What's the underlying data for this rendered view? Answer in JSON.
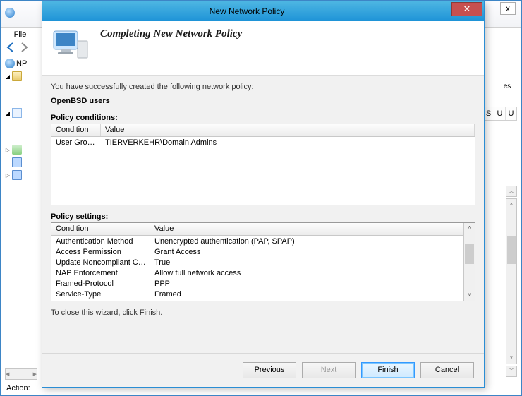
{
  "bg": {
    "file_menu": "File",
    "tree_root": "NP",
    "action_label": "Action:",
    "close_x": "x",
    "detail": "es",
    "cols": [
      "S",
      "U",
      "U"
    ]
  },
  "dialog": {
    "title": "New Network Policy",
    "heading": "Completing New Network Policy",
    "intro": "You have successfully created the following network policy:",
    "policy_name": "OpenBSD users",
    "conditions_label": "Policy conditions:",
    "conditions_headers": [
      "Condition",
      "Value"
    ],
    "conditions": [
      {
        "c": "User Groups",
        "v": "TIERVERKEHR\\Domain Admins"
      }
    ],
    "settings_label": "Policy settings:",
    "settings_headers": [
      "Condition",
      "Value"
    ],
    "settings": [
      {
        "c": "Authentication Method",
        "v": "Unencrypted authentication (PAP, SPAP)"
      },
      {
        "c": "Access Permission",
        "v": "Grant Access"
      },
      {
        "c": "Update Noncompliant Clients",
        "v": "True"
      },
      {
        "c": "NAP Enforcement",
        "v": "Allow full network access"
      },
      {
        "c": "Framed-Protocol",
        "v": "PPP"
      },
      {
        "c": "Service-Type",
        "v": "Framed"
      }
    ],
    "close_note": "To close this wizard, click Finish.",
    "buttons": {
      "previous": "Previous",
      "next": "Next",
      "finish": "Finish",
      "cancel": "Cancel"
    }
  }
}
